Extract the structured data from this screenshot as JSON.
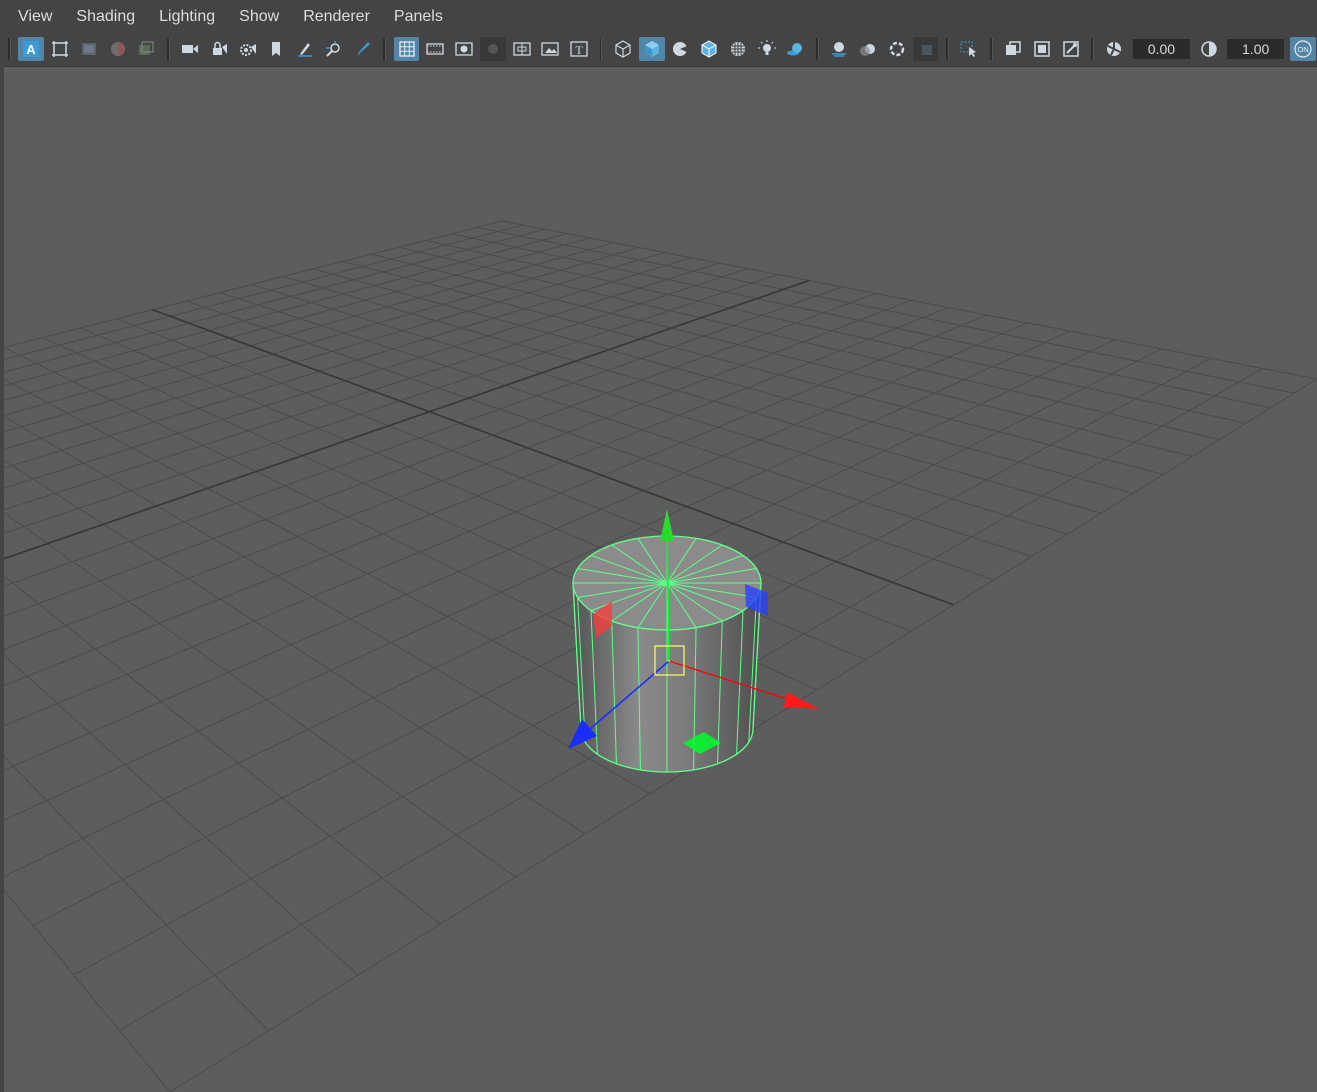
{
  "menubar": {
    "items": [
      {
        "label": "View"
      },
      {
        "label": "Shading"
      },
      {
        "label": "Lighting"
      },
      {
        "label": "Show"
      },
      {
        "label": "Renderer"
      },
      {
        "label": "Panels"
      }
    ]
  },
  "toolbar": {
    "exposure_value": "0.00",
    "gamma_value": "1.00",
    "color_mgmt_label": "ON",
    "accent_color": "#5285a6"
  },
  "viewport": {
    "object": "cylinder",
    "selection_color": "#61ff8a",
    "grid_color": "#4a4a4a",
    "background_color": "#5d5d5d"
  }
}
